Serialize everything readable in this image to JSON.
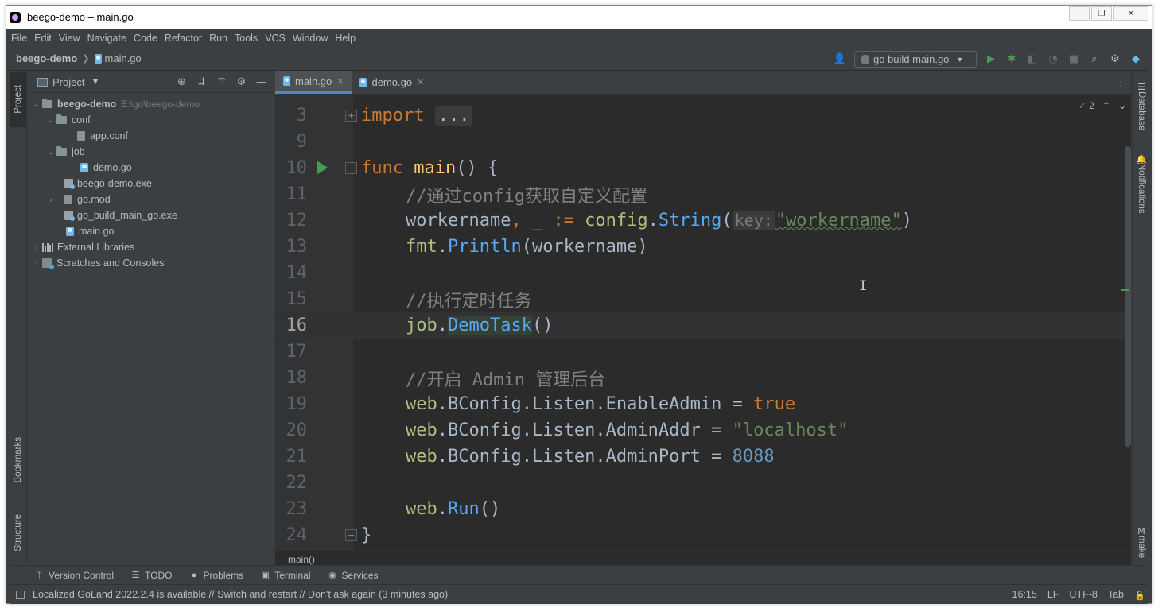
{
  "window": {
    "title": "beego-demo – main.go",
    "controls": [
      "—",
      "❐",
      "✕"
    ]
  },
  "menu": [
    "File",
    "Edit",
    "View",
    "Navigate",
    "Code",
    "Refactor",
    "Run",
    "Tools",
    "VCS",
    "Window",
    "Help"
  ],
  "navbar": {
    "project": "beego-demo",
    "file": "main.go",
    "run_config": "go build main.go"
  },
  "left_strip": {
    "project_tab": "Project",
    "bookmarks_tab": "Bookmarks",
    "structure_tab": "Structure"
  },
  "project_panel": {
    "title": "Project",
    "tree": [
      {
        "label": "beego-demo",
        "hint": "E:\\go\\beego-demo"
      },
      {
        "label": "conf"
      },
      {
        "label": "app.conf"
      },
      {
        "label": "job"
      },
      {
        "label": "demo.go"
      },
      {
        "label": "beego-demo.exe"
      },
      {
        "label": "go.mod"
      },
      {
        "label": "go_build_main_go.exe"
      },
      {
        "label": "main.go"
      },
      {
        "label": "External Libraries"
      },
      {
        "label": "Scratches and Consoles"
      }
    ]
  },
  "editor": {
    "tabs": [
      {
        "label": "main.go",
        "active": true
      },
      {
        "label": "demo.go",
        "active": false
      }
    ],
    "inspection_count": "2",
    "line_numbers": [
      "3",
      "9",
      "10",
      "11",
      "12",
      "13",
      "14",
      "15",
      "16",
      "17",
      "18",
      "19",
      "20",
      "21",
      "22",
      "23",
      "24"
    ],
    "current_line": "16",
    "code": {
      "l3_kw": "import",
      "l3_fold": "...",
      "l10_kw": "func",
      "l10_fn": "main",
      "l10_rest": "() {",
      "l11_comment": "//通过config获取自定义配置",
      "l12_var": "workername",
      "l12_op": ", _ := ",
      "l12_pkg": "config",
      "l12_dot": ".",
      "l12_method": "String",
      "l12_open": "(",
      "l12_hint": "key:",
      "l12_str": "\"workername\"",
      "l12_close": ")",
      "l13_pkg": "fmt",
      "l13_dot": ".",
      "l13_method": "Println",
      "l13_args": "(workername)",
      "l15_comment": "//执行定时任务",
      "l16_pkg": "job",
      "l16_dot": ".",
      "l16_method": "DemoTask",
      "l16_args": "()",
      "l18_comment": "//开启 Admin 管理后台",
      "l19_pkg": "web",
      "l19_mid": ".BConfig.Listen.EnableAdmin",
      "l19_op": " = ",
      "l19_val": "true",
      "l20_pkg": "web",
      "l20_mid": ".BConfig.Listen.AdminAddr",
      "l20_op": " = ",
      "l20_val": "\"localhost\"",
      "l21_pkg": "web",
      "l21_mid": ".BConfig.Listen.AdminPort",
      "l21_op": " = ",
      "l21_val": "8088",
      "l23_pkg": "web",
      "l23_dot": ".",
      "l23_method": "Run",
      "l23_args": "()",
      "l24_brace": "}"
    },
    "breadcrumb": "main()"
  },
  "right_strip": {
    "database_tab": "Database",
    "notifications_tab": "Notifications",
    "make_tab": "make"
  },
  "bottom_tools": [
    "Version Control",
    "TODO",
    "Problems",
    "Terminal",
    "Services"
  ],
  "status": {
    "message": "Localized GoLand 2022.2.4 is available // Switch and restart // Don't ask again (3 minutes ago)",
    "position": "16:15",
    "line_sep": "LF",
    "encoding": "UTF-8",
    "indent": "Tab"
  },
  "colors": {
    "keyword": "#cc7832",
    "function": "#ffc66d",
    "comment": "#808080",
    "string": "#6a8759",
    "number": "#6897bb",
    "run_green": "#499c54",
    "background": "#2b2b2b"
  }
}
